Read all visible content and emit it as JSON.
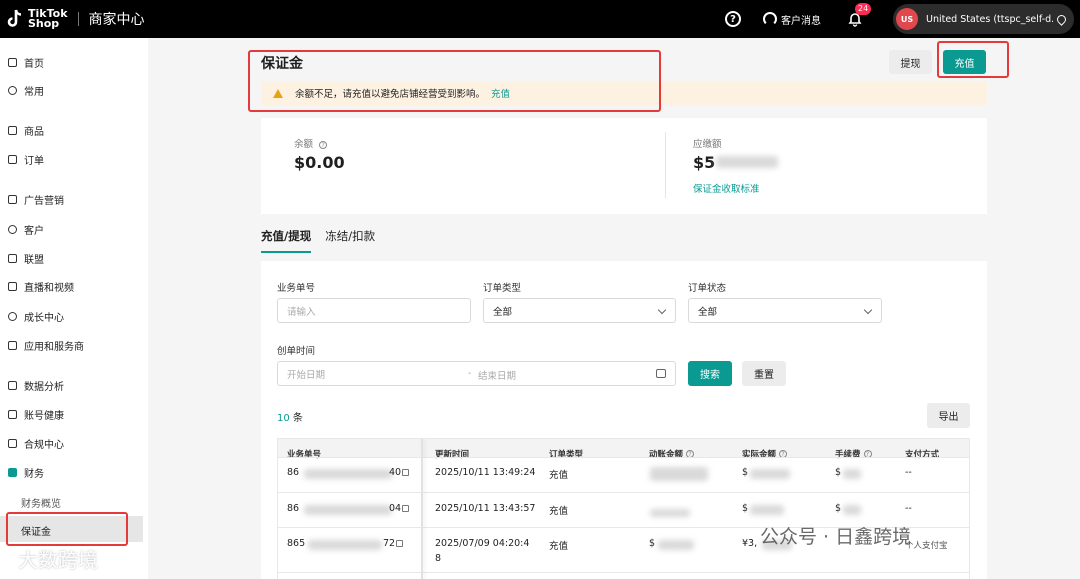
{
  "header": {
    "logo_line1": "TikTok",
    "logo_line2": "Shop",
    "center_title": "商家中心",
    "help_icon": "?",
    "messages_label": "客户消息",
    "bell_badge": "24",
    "account_initials": "US",
    "account_label": "United States  (ttspc_self-d..."
  },
  "sidebar": {
    "items": [
      {
        "label": "首页",
        "icon": "home-icon"
      },
      {
        "label": "常用",
        "icon": "star-icon"
      },
      {
        "label": "商品",
        "icon": "product-icon"
      },
      {
        "label": "订单",
        "icon": "order-icon"
      },
      {
        "label": "广告营销",
        "icon": "megaphone-icon"
      },
      {
        "label": "客户",
        "icon": "customer-icon"
      },
      {
        "label": "联盟",
        "icon": "affiliate-icon"
      },
      {
        "label": "直播和视频",
        "icon": "live-icon"
      },
      {
        "label": "成长中心",
        "icon": "growth-icon"
      },
      {
        "label": "应用和服务商",
        "icon": "apps-icon"
      },
      {
        "label": "数据分析",
        "icon": "analytics-icon"
      },
      {
        "label": "账号健康",
        "icon": "health-icon"
      },
      {
        "label": "合规中心",
        "icon": "compliance-icon"
      },
      {
        "label": "财务",
        "icon": "finance-icon"
      }
    ],
    "sub_items": [
      {
        "label": "财务概览"
      },
      {
        "label": "保证金"
      }
    ]
  },
  "page": {
    "title": "保证金",
    "withdraw_label": "提现",
    "recharge_label": "充值",
    "alert_text": "余额不足，请充值以避免店铺经营受到影响。",
    "alert_link": "充值"
  },
  "balance": {
    "balance_label": "余额",
    "balance_value": "$0.00",
    "due_label": "应缴额",
    "due_value_prefix": "$5",
    "due_link": "保证金收取标准"
  },
  "tabs": [
    {
      "label": "充值/提现",
      "active": true
    },
    {
      "label": "冻结/扣款",
      "active": false
    }
  ],
  "filters": {
    "business_no_label": "业务单号",
    "business_no_placeholder": "请输入",
    "order_type_label": "订单类型",
    "order_type_value": "全部",
    "order_status_label": "订单状态",
    "order_status_value": "全部",
    "created_time_label": "创单时间",
    "start_date_placeholder": "开始日期",
    "date_separator": "-",
    "end_date_placeholder": "结束日期",
    "search_label": "搜索",
    "reset_label": "重置"
  },
  "results": {
    "count_number": "10",
    "count_unit": "条",
    "export_label": "导出"
  },
  "table": {
    "columns": [
      "业务单号",
      "更新时间",
      "订单类型",
      "动账金额",
      "实际金额",
      "手续费",
      "支付方式"
    ],
    "rows": [
      {
        "id_start": "86",
        "id_end": "40",
        "time": "2025/10/11 13:49:24",
        "type": "充值",
        "actual": "$",
        "fee": "$",
        "pay": "--"
      },
      {
        "id_start": "86",
        "id_end": "04",
        "time": "2025/10/11 13:43:57",
        "type": "充值",
        "actual": "$",
        "fee": "$",
        "pay": "--"
      },
      {
        "id_start": "865",
        "id_end": "72",
        "time_line1": "2025/07/09 04:20:4",
        "time_line2": "8",
        "type": "充值",
        "amount": "$",
        "actual": "¥3,",
        "pay": "个人支付宝"
      }
    ]
  },
  "watermark": {
    "left": "大数跨境",
    "right": "公众号 · 日鑫跨境"
  },
  "colors": {
    "accent": "#0a9a92",
    "topbar": "#000000",
    "alert_bg": "#fdf2e2",
    "annotation_red": "#e53a3a",
    "badge_red": "#fe2c55"
  }
}
